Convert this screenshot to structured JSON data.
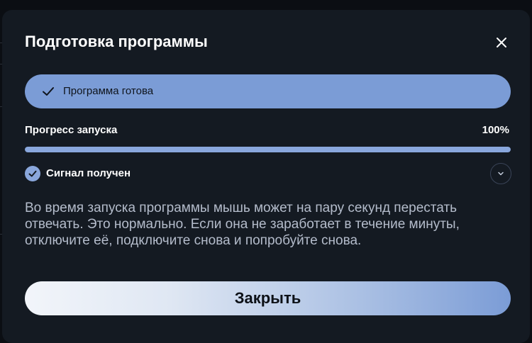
{
  "dialog": {
    "title": "Подготовка программы",
    "close_icon": "close-icon"
  },
  "status": {
    "icon": "check-icon",
    "label": "Программа готова",
    "color": "#7b9cd6"
  },
  "progress": {
    "label": "Прогресс запуска",
    "value_text": "100%",
    "fraction": 1.0,
    "fill_color": "#89a7dd"
  },
  "signal": {
    "icon": "check-circle-icon",
    "label": "Сигнал получен",
    "expand_icon": "chevron-down-icon"
  },
  "message": "Во время запуска программы мышь может на пару секунд перестать отвечать. Это нормально. Если она не заработает в течение минуты, отключите её, подключите снова и попробуйте снова.",
  "actions": {
    "close_label": "Закрыть"
  },
  "colors": {
    "background": "#141a22",
    "accent": "#7b9cd6",
    "text": "#ffffff",
    "muted_text": "#b4bccb"
  }
}
